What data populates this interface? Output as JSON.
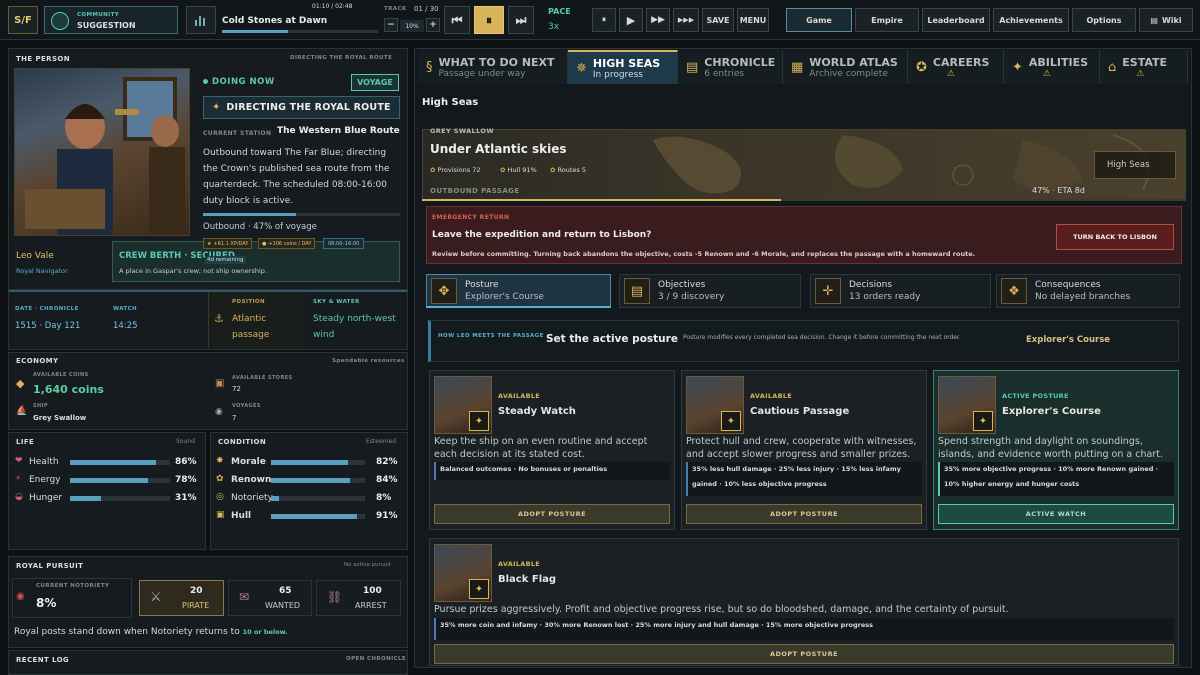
{
  "topbar": {
    "logo": "S/F",
    "community_label": "COMMUNITY",
    "community_value": "SUGGESTION",
    "track_title": "Cold Stones at Dawn",
    "track_time": "01:10 / 02:48",
    "track_label": "TRACK",
    "track_count": "01 / 30",
    "volume": "10%",
    "pace_label": "PACE",
    "pace_value": "3x",
    "save": "SAVE",
    "menu": "MENU",
    "nav": [
      "Game",
      "Empire",
      "Leaderboard",
      "Achievements",
      "Options",
      "Wiki"
    ]
  },
  "person": {
    "header": "THE PERSON",
    "header_right": "DIRECTING THE ROYAL ROUTE",
    "doing_now": "DOING NOW",
    "voyage_badge": "VOYAGE",
    "activity": "DIRECTING THE ROYAL ROUTE",
    "station_label": "CURRENT STATION",
    "station": "The Western Blue Route",
    "description": "Outbound toward The Far Blue; directing the Crown's published sea route from the quarterdeck. The scheduled 08:00-16:00 duty block is active.",
    "progress_text": "Outbound · 47% of voyage",
    "progress": 0.47,
    "name": "Leo Vale",
    "role": "Royal Navigator",
    "berth": "CREW BERTH · SECURED",
    "berth_remaining": "4d remaining",
    "berth_desc": "A place in Gaspar's crew; not ship ownership.",
    "xp": "+61.1 XP/DAY",
    "coins_day": "+106 coins / DAY",
    "duty_time": "08:00–16:00"
  },
  "stats": {
    "date_label": "DATE · CHRONICLE",
    "date": "1515 · Day 121",
    "watch_label": "WATCH",
    "watch": "14:25",
    "position_label": "POSITION",
    "position": "Atlantic passage",
    "sky_label": "SKY & WATER",
    "sky": "Steady north-west wind"
  },
  "economy": {
    "header": "ECONOMY",
    "header_right": "Spendable resources",
    "coins_label": "AVAILABLE COINS",
    "coins": "1,640 coins",
    "stores_label": "AVAILABLE STORES",
    "stores": "72",
    "ship_label": "SHIP",
    "ship": "Grey Swallow",
    "voyages_label": "VOYAGES",
    "voyages": "7"
  },
  "life": {
    "header": "LIFE",
    "header_right": "Sound",
    "items": [
      {
        "label": "Health",
        "value": "86%",
        "level": 0.86
      },
      {
        "label": "Energy",
        "value": "78%",
        "level": 0.78
      },
      {
        "label": "Hunger",
        "value": "31%",
        "level": 0.31
      }
    ]
  },
  "condition": {
    "header": "CONDITION",
    "header_right": "Esteemed",
    "items": [
      {
        "label": "Morale",
        "value": "82%",
        "level": 0.82
      },
      {
        "label": "Renown",
        "value": "84%",
        "level": 0.84
      },
      {
        "label": "Notoriety",
        "value": "8%",
        "level": 0.08
      },
      {
        "label": "Hull",
        "value": "91%",
        "level": 0.91
      }
    ]
  },
  "pursuit": {
    "header": "ROYAL PURSUIT",
    "header_right": "No active pursuit",
    "notoriety_label": "CURRENT NOTORIETY",
    "notoriety": "8%",
    "tiers": [
      {
        "num": "20",
        "label": "PIRATE"
      },
      {
        "num": "65",
        "label": "WANTED"
      },
      {
        "num": "100",
        "label": "ARREST"
      }
    ],
    "note": "Royal posts stand down when Notoriety returns to",
    "note_strong": "10 or below."
  },
  "log": {
    "header": "RECENT LOG",
    "header_right": "OPEN CHRONICLE"
  },
  "tabs": [
    {
      "title": "WHAT TO DO NEXT",
      "sub": "Passage under way"
    },
    {
      "title": "HIGH SEAS",
      "sub": "In progress"
    },
    {
      "title": "CHRONICLE",
      "sub": "6 entries"
    },
    {
      "title": "WORLD ATLAS",
      "sub": "Archive complete"
    },
    {
      "title": "CAREERS",
      "sub": "⚠"
    },
    {
      "title": "ABILITIES",
      "sub": "⚠"
    },
    {
      "title": "ESTATE",
      "sub": "⚠"
    }
  ],
  "highseas": {
    "title": "High Seas",
    "ship_name": "GREY SWALLOW",
    "sky": "Under Atlantic skies",
    "provisions": "Provisions 72",
    "hull": "Hull 91%",
    "routes": "Routes 5",
    "badge": "High Seas",
    "passage_label": "OUTBOUND PASSAGE",
    "eta": "47% · ETA 8d",
    "emergency_label": "EMERGENCY RETURN",
    "emergency_title": "Leave the expedition and return to Lisbon?",
    "emergency_text": "Review before committing. Turning back abandons the objective, costs -5 Renown and -6 Morale, and replaces the passage with a homeward route.",
    "emergency_button": "TURN BACK TO LISBON"
  },
  "subtabs": [
    {
      "title": "Posture",
      "sub": "Explorer's Course"
    },
    {
      "title": "Objectives",
      "sub": "3 / 9 discovery"
    },
    {
      "title": "Decisions",
      "sub": "13 orders ready"
    },
    {
      "title": "Consequences",
      "sub": "No delayed branches"
    }
  ],
  "posture": {
    "label": "HOW LEO MEETS THE PASSAGE",
    "title": "Set the active posture",
    "desc": "Posture modifies every completed sea decision. Change it before committing the next order.",
    "current": "Explorer's Course"
  },
  "cards": [
    {
      "tag": "AVAILABLE",
      "title": "Steady Watch",
      "desc": "Keep the ship on an even routine and accept each decision at its stated cost.",
      "note": "Balanced outcomes · No bonuses or penalties",
      "button": "ADOPT POSTURE"
    },
    {
      "tag": "AVAILABLE",
      "title": "Cautious Passage",
      "desc": "Protect hull and crew, cooperate with witnesses, and accept slower progress and smaller prizes.",
      "note": "35% less hull damage · 25% less injury · 15% less infamy gained · 10% less objective progress",
      "button": "ADOPT POSTURE"
    },
    {
      "tag": "ACTIVE POSTURE",
      "title": "Explorer's Course",
      "desc": "Spend strength and daylight on soundings, islands, and evidence worth putting on a chart.",
      "note": "35% more objective progress · 10% more Renown gained · 10% higher energy and hunger costs",
      "button": "ACTIVE WATCH"
    },
    {
      "tag": "AVAILABLE",
      "title": "Black Flag",
      "desc": "Pursue prizes aggressively. Profit and objective progress rise, but so do bloodshed, damage, and the certainty of pursuit.",
      "note": "35% more coin and infamy · 30% more Renown lost · 25% more injury and hull damage · 15% more objective progress",
      "button": "ADOPT POSTURE"
    }
  ]
}
